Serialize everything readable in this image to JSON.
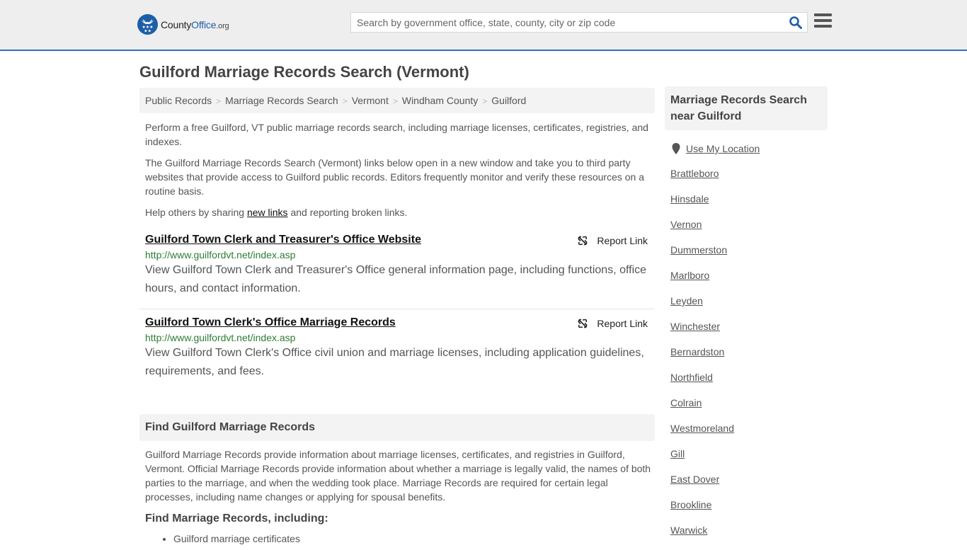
{
  "header": {
    "logo": {
      "county": "County",
      "office": "Office",
      "org": ".org"
    },
    "search": {
      "placeholder": "Search by government office, state, county, city or zip code",
      "value": ""
    },
    "brand_color": "#1d5ea8",
    "accent_border_color": "#2d72b0"
  },
  "page": {
    "title": "Guilford Marriage Records Search (Vermont)"
  },
  "breadcrumb": [
    "Public Records",
    "Marriage Records Search",
    "Vermont",
    "Windham County",
    "Guilford"
  ],
  "intro": {
    "p1": "Perform a free Guilford, VT public marriage records search, including marriage licenses, certificates, registries, and indexes.",
    "p2": "The Guilford Marriage Records Search (Vermont) links below open in a new window and take you to third party websites that provide access to Guilford public records. Editors frequently monitor and verify these resources on a routine basis.",
    "p3_before": "Help others by sharing ",
    "p3_link": "new links",
    "p3_after": " and reporting broken links."
  },
  "entries": [
    {
      "title": "Guilford Town Clerk and Treasurer's Office Website",
      "url": "http://www.guilfordvt.net/index.asp",
      "description": "View Guilford Town Clerk and Treasurer's Office general information page, including functions, office hours, and contact information.",
      "report_label": "Report Link"
    },
    {
      "title": "Guilford Town Clerk's Office Marriage Records",
      "url": "http://www.guilfordvt.net/index.asp",
      "description": "View Guilford Town Clerk's Office civil union and marriage licenses, including application guidelines, requirements, and fees.",
      "report_label": "Report Link"
    }
  ],
  "find_section": {
    "heading": "Find Guilford Marriage Records",
    "body": "Guilford Marriage Records provide information about marriage licenses, certificates, and registries in Guilford, Vermont. Official Marriage Records provide information about whether a marriage is legally valid, the names of both parties to the marriage, and when the wedding took place. Marriage Records are required for certain legal processes, including name changes or applying for spousal benefits.",
    "subheading": "Find Marriage Records, including:",
    "bullets": [
      "Guilford marriage certificates"
    ]
  },
  "sidebar": {
    "heading": "Marriage Records Search near Guilford",
    "use_location": "Use My Location",
    "nearby": [
      "Brattleboro",
      "Hinsdale",
      "Vernon",
      "Dummerston",
      "Marlboro",
      "Leyden",
      "Winchester",
      "Bernardston",
      "Northfield",
      "Colrain",
      "Westmoreland",
      "Gill",
      "East Dover",
      "Brookline",
      "Warwick"
    ]
  }
}
